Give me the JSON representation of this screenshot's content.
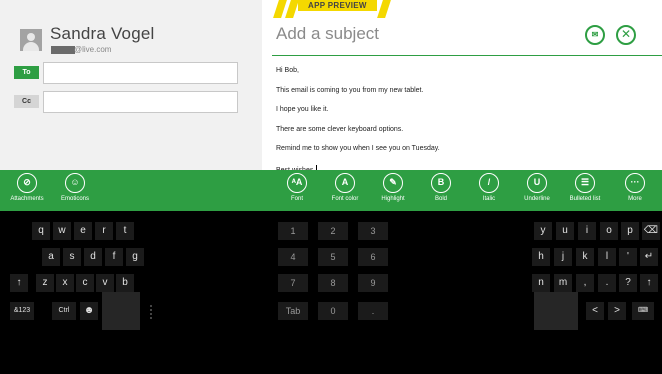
{
  "mail": {
    "sender_name": "Sandra Vogel",
    "sender_email": "@live.com",
    "to_label": "To",
    "cc_label": "Cc",
    "preview_banner": "APP PREVIEW",
    "subject_placeholder": "Add a subject",
    "body_lines": [
      "Hi Bob,",
      "This email is coming to you from my new tablet.",
      "I hope you like it.",
      "There are some clever keyboard options.",
      "Remind me to show you when I see you on Tuesday.",
      "Best wishes,"
    ]
  },
  "colors": {
    "accent": "#2e9e43",
    "banner": "#f4d800",
    "keyboard_bg": "#000000",
    "key_bg": "#1b1b1b"
  },
  "toolbar": {
    "items": [
      {
        "label": "Attachments",
        "icon": "paperclip-icon",
        "glyph": "⊘"
      },
      {
        "label": "Emoticons",
        "icon": "smiley-icon",
        "glyph": "☺"
      },
      {
        "label": "Font",
        "icon": "font-icon",
        "glyph": "ᴬA"
      },
      {
        "label": "Font color",
        "icon": "font-color-icon",
        "glyph": "A"
      },
      {
        "label": "Highlight",
        "icon": "highlight-icon",
        "glyph": "✎"
      },
      {
        "label": "Bold",
        "icon": "bold-icon",
        "glyph": "B"
      },
      {
        "label": "Italic",
        "icon": "italic-icon",
        "glyph": "/"
      },
      {
        "label": "Underline",
        "icon": "underline-icon",
        "glyph": "U"
      },
      {
        "label": "Bulleted list",
        "icon": "bulleted-list-icon",
        "glyph": "☰"
      },
      {
        "label": "More",
        "icon": "more-icon",
        "glyph": "···"
      }
    ]
  },
  "keyboard": {
    "left_rows": [
      [
        "q",
        "w",
        "e",
        "r",
        "t"
      ],
      [
        "a",
        "s",
        "d",
        "f",
        "g"
      ],
      [
        "↑",
        "z",
        "x",
        "c",
        "v",
        "b"
      ],
      [
        "&123",
        "Ctrl",
        "☻",
        ""
      ]
    ],
    "numpad": [
      [
        "1",
        "2",
        "3"
      ],
      [
        "4",
        "5",
        "6"
      ],
      [
        "7",
        "8",
        "9"
      ],
      [
        "Tab",
        "0",
        "."
      ]
    ],
    "right_rows": [
      [
        "y",
        "u",
        "i",
        "o",
        "p",
        "⌫"
      ],
      [
        "h",
        "j",
        "k",
        "l",
        "'",
        "↵"
      ],
      [
        "n",
        "m",
        ",",
        ".",
        "?",
        "↑"
      ],
      [
        "",
        "<",
        ">",
        "⌨"
      ]
    ]
  }
}
